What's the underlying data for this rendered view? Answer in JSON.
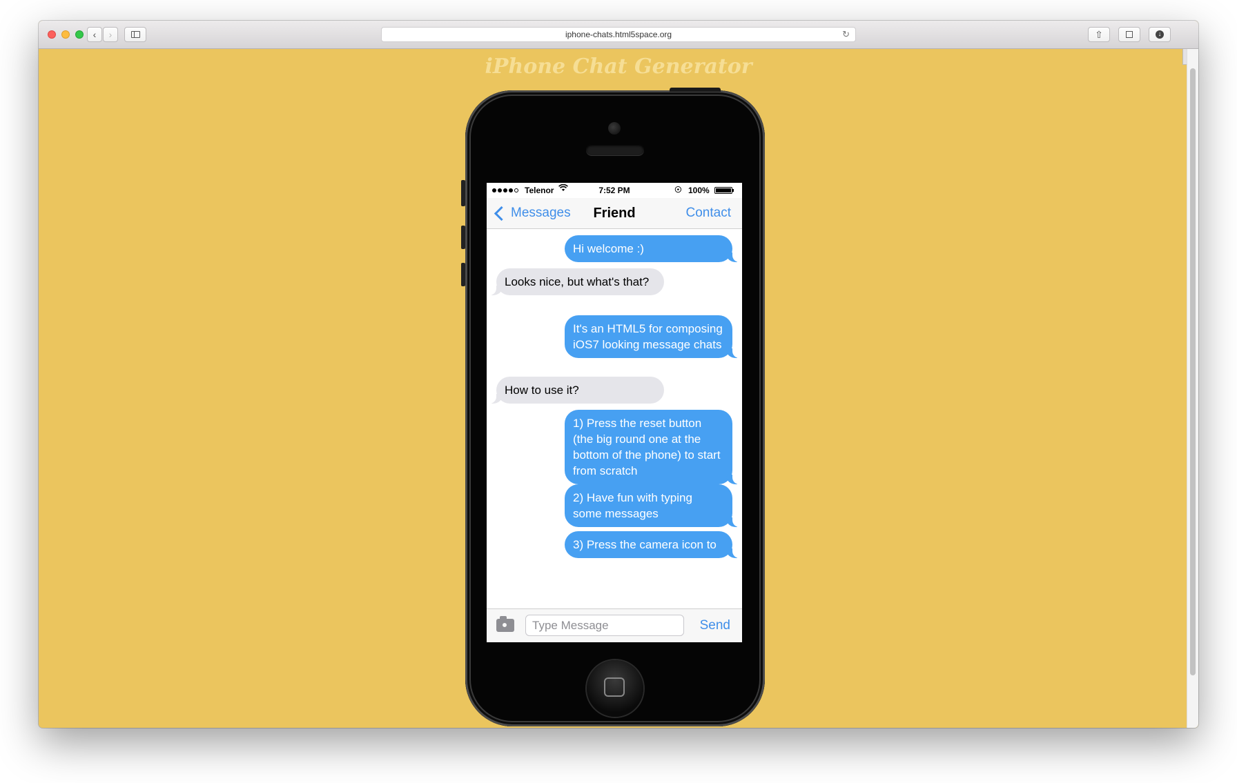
{
  "browser": {
    "url": "iphone-chats.html5space.org",
    "new_tab_label": "+"
  },
  "page": {
    "title": "iPhone Chat Generator"
  },
  "status_bar": {
    "carrier": "Telenor",
    "time": "7:52 PM",
    "battery": "100%",
    "battery_level": 1.0,
    "signal_filled": 4,
    "signal_total": 5
  },
  "nav": {
    "back_label": "Messages",
    "title": "Friend",
    "contact_label": "Contact"
  },
  "messages": [
    {
      "direction": "out",
      "text": "Hi welcome :)"
    },
    {
      "direction": "in",
      "text": "Looks nice, but what's that?"
    },
    {
      "direction": "out",
      "text": "It's an HTML5 for composing iOS7 looking message chats"
    },
    {
      "direction": "in",
      "text": "How to use it?"
    },
    {
      "direction": "out",
      "text": "1) Press the reset button (the big round one at the bottom of the phone) to start from scratch"
    },
    {
      "direction": "out",
      "text": "2) Have fun with typing some messages"
    },
    {
      "direction": "out",
      "text": "3) Press the camera icon to"
    }
  ],
  "composer": {
    "placeholder": "Type Message",
    "send_label": "Send"
  },
  "colors": {
    "background": "#EBC55E",
    "outgoing_bubble": "#47A0F2",
    "incoming_bubble": "#E5E5EA",
    "ios_blue": "#3F8EE9"
  }
}
